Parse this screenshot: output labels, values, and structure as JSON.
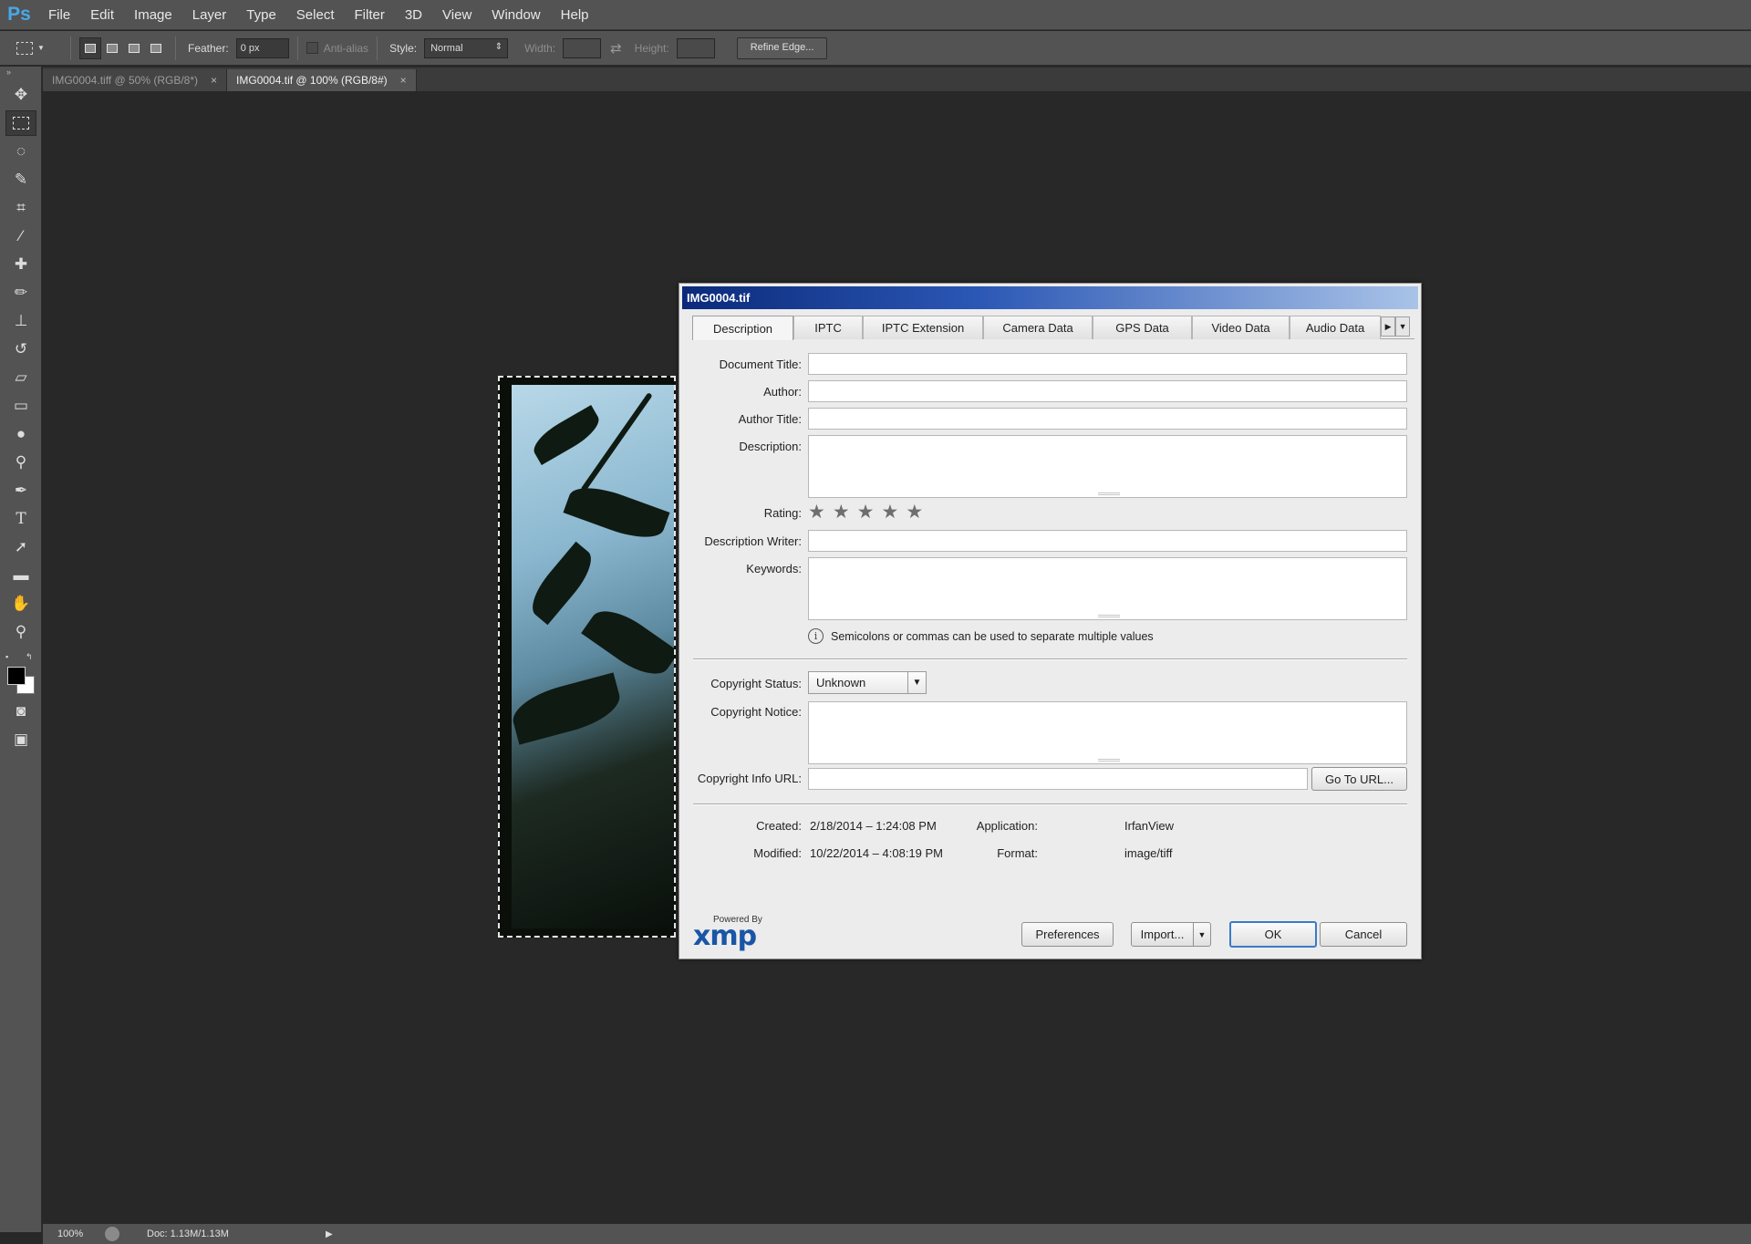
{
  "app": {
    "logo": "Ps"
  },
  "menu": [
    "File",
    "Edit",
    "Image",
    "Layer",
    "Type",
    "Select",
    "Filter",
    "3D",
    "View",
    "Window",
    "Help"
  ],
  "options": {
    "feather_label": "Feather:",
    "feather_value": "0 px",
    "antialias_label": "Anti-alias",
    "style_label": "Style:",
    "style_value": "Normal",
    "width_label": "Width:",
    "height_label": "Height:",
    "refine_label": "Refine Edge..."
  },
  "doc_tabs": [
    {
      "label": "IMG0004.tiff @ 50% (RGB/8*)",
      "close": "×"
    },
    {
      "label": "IMG0004.tif @ 100% (RGB/8#)",
      "close": "×"
    }
  ],
  "status": {
    "zoom": "100%",
    "doc": "Doc: 1.13M/1.13M"
  },
  "dialog": {
    "title": "IMG0004.tif",
    "tabs": [
      "Description",
      "IPTC",
      "IPTC Extension",
      "Camera Data",
      "GPS Data",
      "Video Data",
      "Audio Data"
    ],
    "labels": {
      "document_title": "Document Title:",
      "author": "Author:",
      "author_title": "Author Title:",
      "description": "Description:",
      "rating": "Rating:",
      "description_writer": "Description Writer:",
      "keywords": "Keywords:",
      "copyright_status": "Copyright Status:",
      "copyright_notice": "Copyright Notice:",
      "copyright_url": "Copyright Info URL:",
      "created": "Created:",
      "modified": "Modified:",
      "application": "Application:",
      "format": "Format:"
    },
    "hint": "Semicolons or commas can be used to separate multiple values",
    "copyright_status_value": "Unknown",
    "rating_value": 0,
    "meta": {
      "created": "2/18/2014 – 1:24:08 PM",
      "modified": "10/22/2014 – 4:08:19 PM",
      "application": "IrfanView",
      "format": "image/tiff"
    },
    "buttons": {
      "goto_url": "Go To URL...",
      "preferences": "Preferences",
      "import": "Import...",
      "ok": "OK",
      "cancel": "Cancel"
    },
    "xmp": {
      "powered_by": "Powered By",
      "logo": "xmp"
    }
  }
}
